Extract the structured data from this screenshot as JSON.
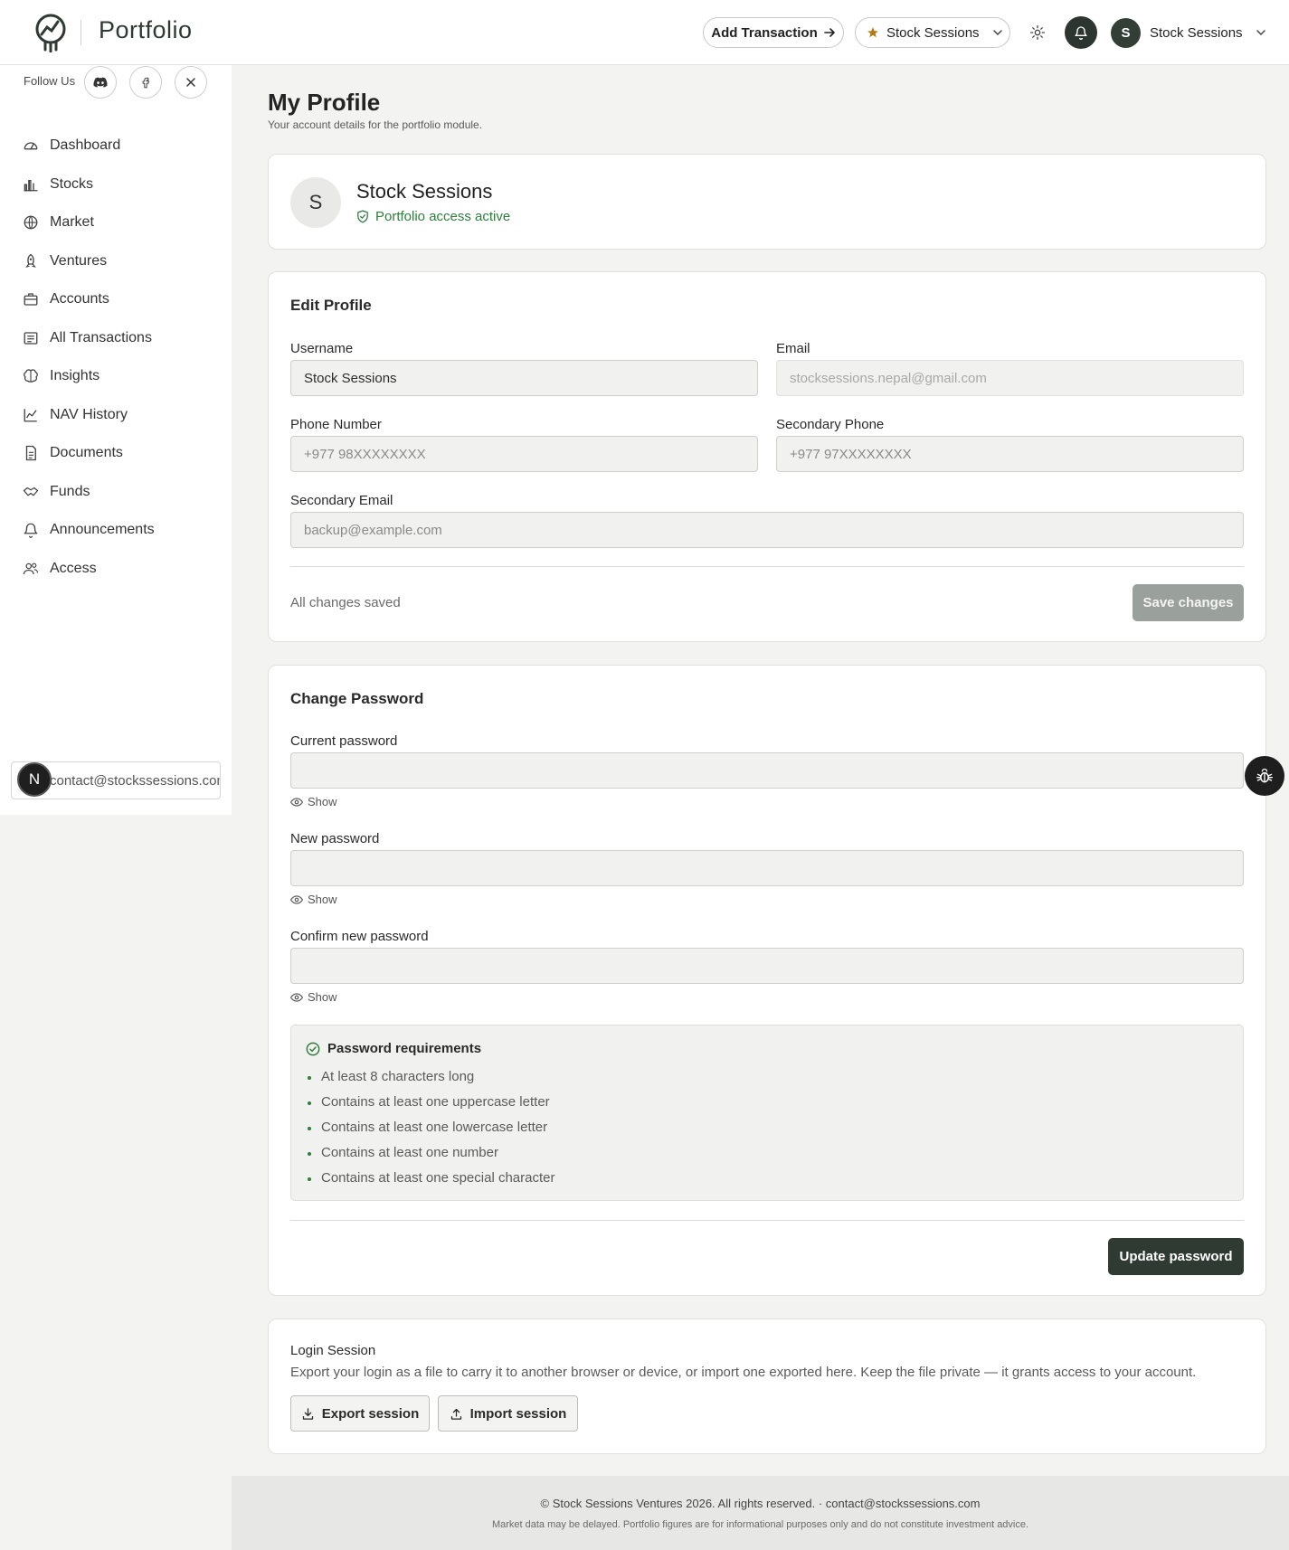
{
  "header": {
    "brand": "Portfolio",
    "add_transaction": "Add Transaction",
    "portfolio_select": "Stock Sessions",
    "user_name": "Stock Sessions",
    "user_initial": "S"
  },
  "sidebar": {
    "follow_label": "Follow Us",
    "social": [
      "discord-icon",
      "facebook-icon",
      "x-icon"
    ],
    "items": [
      {
        "label": "Dashboard",
        "icon": "dashboard-icon"
      },
      {
        "label": "Stocks",
        "icon": "bar-chart-icon"
      },
      {
        "label": "Market",
        "icon": "globe-icon"
      },
      {
        "label": "Ventures",
        "icon": "rocket-icon"
      },
      {
        "label": "Accounts",
        "icon": "briefcase-icon"
      },
      {
        "label": "All Transactions",
        "icon": "receipt-icon"
      },
      {
        "label": "Insights",
        "icon": "brain-icon"
      },
      {
        "label": "NAV History",
        "icon": "line-chart-icon"
      },
      {
        "label": "Documents",
        "icon": "document-icon"
      },
      {
        "label": "Funds",
        "icon": "handshake-icon"
      },
      {
        "label": "Announcements",
        "icon": "bell-icon"
      },
      {
        "label": "Access",
        "icon": "users-icon"
      }
    ],
    "contact": "contact@stockssessions.com",
    "n_badge": "N"
  },
  "page": {
    "title": "My Profile",
    "subtitle": "Your account details for the portfolio module."
  },
  "profile": {
    "initial": "S",
    "name": "Stock Sessions",
    "status": "Portfolio access active"
  },
  "edit_profile": {
    "title": "Edit Profile",
    "username_label": "Username",
    "username_value": "Stock Sessions",
    "email_label": "Email",
    "email_value": "stocksessions.nepal@gmail.com",
    "phone_label": "Phone Number",
    "phone_placeholder": "+977 98XXXXXXXX",
    "secondary_phone_label": "Secondary Phone",
    "secondary_phone_placeholder": "+977 97XXXXXXXX",
    "secondary_email_label": "Secondary Email",
    "secondary_email_placeholder": "backup@example.com",
    "saved_status": "All changes saved",
    "save_button": "Save changes"
  },
  "change_password": {
    "title": "Change Password",
    "current_label": "Current password",
    "new_label": "New password",
    "confirm_label": "Confirm new password",
    "show_label": "Show",
    "requirements_title": "Password requirements",
    "requirements": [
      "At least 8 characters long",
      "Contains at least one uppercase letter",
      "Contains at least one lowercase letter",
      "Contains at least one number",
      "Contains at least one special character"
    ],
    "update_button": "Update password"
  },
  "login_session": {
    "title": "Login Session",
    "description": "Export your login as a file to carry it to another browser or device, or import one exported here. Keep the file private — it grants access to your account.",
    "export_button": "Export session",
    "import_button": "Import session"
  },
  "footer": {
    "copyright": "© Stock Sessions Ventures 2026. All rights reserved. · contact@stockssessions.com",
    "disclaimer": "Market data may be delayed. Portfolio figures are for informational purposes only and do not constitute investment advice."
  },
  "colors": {
    "accent_dark": "#2f3a33",
    "success": "#2e7d3e",
    "star": "#b07a12"
  }
}
